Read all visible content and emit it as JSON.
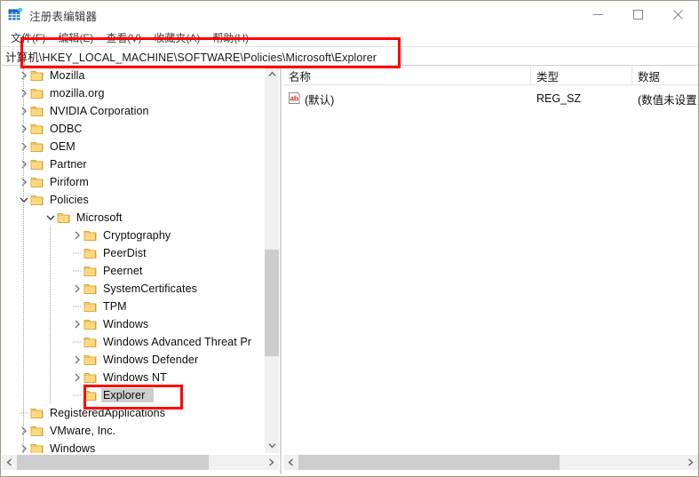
{
  "window": {
    "title": "注册表编辑器",
    "app_icon": "registry-editor-icon",
    "minimize_label": "—",
    "maximize_label": "□",
    "close_label": "✕"
  },
  "menubar": {
    "items": [
      {
        "label": "文件(F)"
      },
      {
        "label": "编辑(E)"
      },
      {
        "label": "查看(V)"
      },
      {
        "label": "收藏夹(A)"
      },
      {
        "label": "帮助(H)"
      }
    ]
  },
  "address": {
    "value": "计算机\\HKEY_LOCAL_MACHINE\\SOFTWARE\\Policies\\Microsoft\\Explorer"
  },
  "tree": {
    "items": [
      {
        "label": "Mozilla",
        "depth": 1,
        "state": "collapsed",
        "selected": false
      },
      {
        "label": "mozilla.org",
        "depth": 1,
        "state": "collapsed",
        "selected": false
      },
      {
        "label": "NVIDIA Corporation",
        "depth": 1,
        "state": "collapsed",
        "selected": false
      },
      {
        "label": "ODBC",
        "depth": 1,
        "state": "collapsed",
        "selected": false
      },
      {
        "label": "OEM",
        "depth": 1,
        "state": "collapsed",
        "selected": false
      },
      {
        "label": "Partner",
        "depth": 1,
        "state": "collapsed",
        "selected": false
      },
      {
        "label": "Piriform",
        "depth": 1,
        "state": "collapsed",
        "selected": false
      },
      {
        "label": "Policies",
        "depth": 1,
        "state": "expanded",
        "selected": false
      },
      {
        "label": "Microsoft",
        "depth": 2,
        "state": "expanded",
        "selected": false
      },
      {
        "label": "Cryptography",
        "depth": 3,
        "state": "collapsed",
        "selected": false
      },
      {
        "label": "PeerDist",
        "depth": 3,
        "state": "leaf",
        "selected": false
      },
      {
        "label": "Peernet",
        "depth": 3,
        "state": "leaf",
        "selected": false
      },
      {
        "label": "SystemCertificates",
        "depth": 3,
        "state": "collapsed",
        "selected": false
      },
      {
        "label": "TPM",
        "depth": 3,
        "state": "leaf",
        "selected": false
      },
      {
        "label": "Windows",
        "depth": 3,
        "state": "collapsed",
        "selected": false
      },
      {
        "label": "Windows Advanced Threat Pr",
        "depth": 3,
        "state": "leaf",
        "selected": false
      },
      {
        "label": "Windows Defender",
        "depth": 3,
        "state": "collapsed",
        "selected": false
      },
      {
        "label": "Windows NT",
        "depth": 3,
        "state": "collapsed",
        "selected": false
      },
      {
        "label": "Explorer",
        "depth": 3,
        "state": "leaf",
        "selected": true
      },
      {
        "label": "RegisteredApplications",
        "depth": 1,
        "state": "leaf",
        "selected": false
      },
      {
        "label": "VMware, Inc.",
        "depth": 1,
        "state": "collapsed",
        "selected": false
      },
      {
        "label": "Windows",
        "depth": 1,
        "state": "collapsed",
        "selected": false
      }
    ]
  },
  "values_list": {
    "columns": [
      {
        "label": "名称"
      },
      {
        "label": "类型"
      },
      {
        "label": "数据"
      }
    ],
    "rows": [
      {
        "icon": "string-value-icon",
        "name": "(默认)",
        "type": "REG_SZ",
        "data": "(数值未设置"
      }
    ]
  },
  "scrollbars": {
    "tree_up_arrow": "▲",
    "tree_down_arrow": "▼",
    "tree_left_arrow": "❮",
    "tree_right_arrow": "❯",
    "list_left_arrow": "❮",
    "list_right_arrow": "❯"
  },
  "annotations": {
    "accent_color": "#ff0000",
    "boxes": [
      {
        "name": "address-bar-highlight"
      },
      {
        "name": "explorer-key-highlight"
      }
    ]
  }
}
